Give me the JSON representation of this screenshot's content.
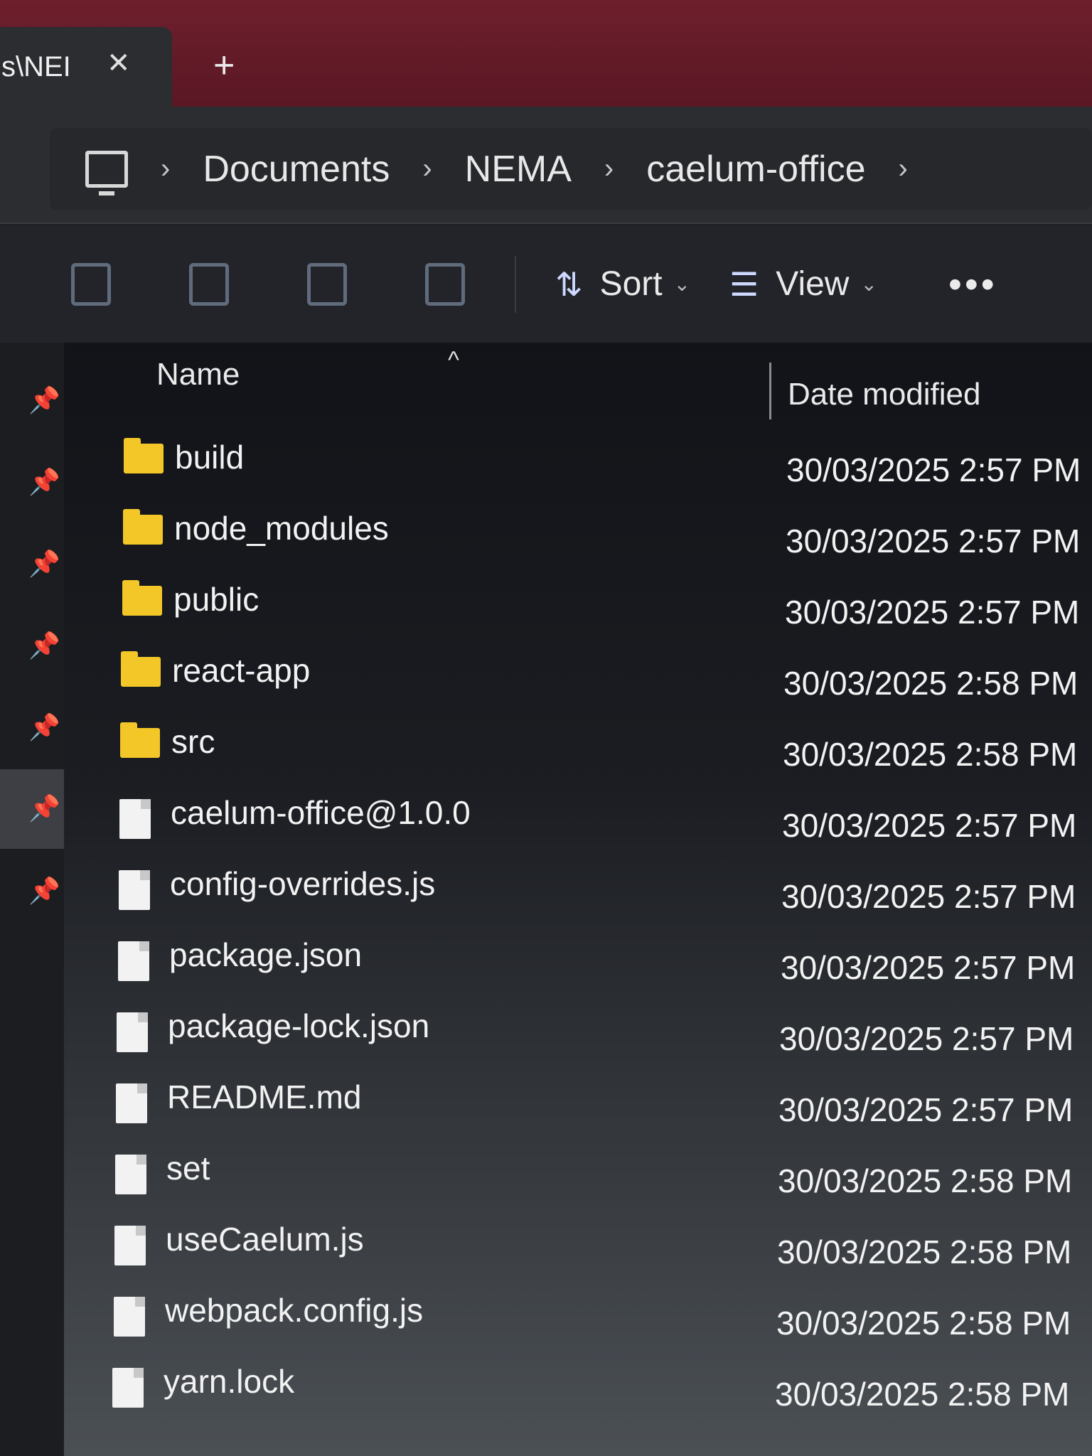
{
  "tab": {
    "title": "s\\NEI",
    "close_glyph": "✕",
    "new_tab_glyph": "+"
  },
  "breadcrumb": {
    "root_icon": "this-pc-icon",
    "separator": "›",
    "items": [
      "Documents",
      "NEMA",
      "caelum-office"
    ]
  },
  "toolbar": {
    "icons": [
      "paste-icon",
      "rename-icon",
      "share-icon",
      "delete-icon"
    ],
    "sort_label": "Sort",
    "view_label": "View",
    "more_glyph": "•••"
  },
  "columns": {
    "name": "Name",
    "date": "Date modified"
  },
  "files": [
    {
      "name": "build",
      "type": "folder",
      "date": "30/03/2025 2:57 PM"
    },
    {
      "name": "node_modules",
      "type": "folder",
      "date": "30/03/2025 2:57 PM"
    },
    {
      "name": "public",
      "type": "folder",
      "date": "30/03/2025 2:57 PM"
    },
    {
      "name": "react-app",
      "type": "folder",
      "date": "30/03/2025 2:58 PM"
    },
    {
      "name": "src",
      "type": "folder",
      "date": "30/03/2025 2:58 PM"
    },
    {
      "name": "caelum-office@1.0.0",
      "type": "file",
      "date": "30/03/2025 2:57 PM"
    },
    {
      "name": "config-overrides.js",
      "type": "file",
      "date": "30/03/2025 2:57 PM"
    },
    {
      "name": "package.json",
      "type": "file",
      "date": "30/03/2025 2:57 PM"
    },
    {
      "name": "package-lock.json",
      "type": "file",
      "date": "30/03/2025 2:57 PM"
    },
    {
      "name": "README.md",
      "type": "file",
      "date": "30/03/2025 2:57 PM"
    },
    {
      "name": "set",
      "type": "file",
      "date": "30/03/2025 2:58 PM"
    },
    {
      "name": "useCaelum.js",
      "type": "file",
      "date": "30/03/2025 2:58 PM"
    },
    {
      "name": "webpack.config.js",
      "type": "file",
      "date": "30/03/2025 2:58 PM"
    },
    {
      "name": "yarn.lock",
      "type": "file",
      "date": "30/03/2025 2:58 PM"
    }
  ],
  "colors": {
    "titlebar": "#6e1f2c",
    "folder": "#f3c728",
    "accent": "#cfd8ff"
  }
}
